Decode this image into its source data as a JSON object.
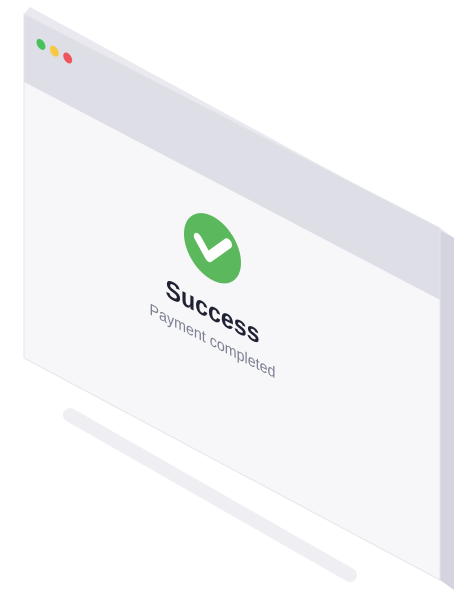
{
  "window": {
    "controls": [
      {
        "name": "green-dot",
        "color": "#45C25A"
      },
      {
        "name": "yellow-dot",
        "color": "#F7C844"
      },
      {
        "name": "red-dot",
        "color": "#F0545C"
      }
    ],
    "frame_color": "#DDDEE6",
    "body_color": "#F7F7F9"
  },
  "dialog": {
    "icon": "checkmark-icon",
    "icon_color": "#5CB85C",
    "title": "Success",
    "subtitle": "Payment completed"
  },
  "colors": {
    "title": "#1F2233",
    "subtitle": "#7D8091",
    "shadow": "#EFEFF3"
  }
}
